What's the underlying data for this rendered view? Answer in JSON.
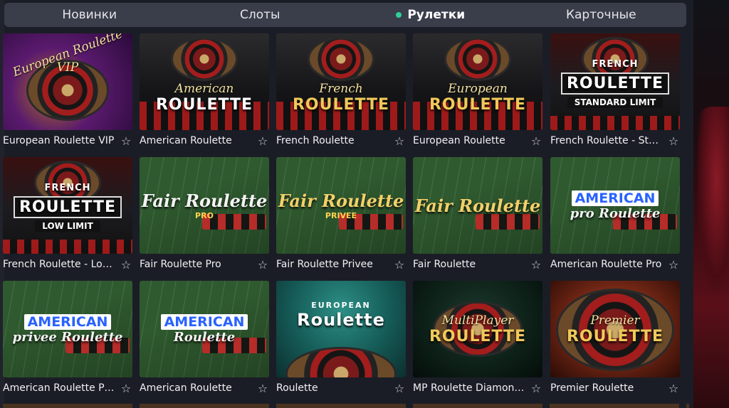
{
  "tabs": [
    {
      "label": "Новинки",
      "active": false
    },
    {
      "label": "Слоты",
      "active": false
    },
    {
      "label": "Рулетки",
      "active": true
    },
    {
      "label": "Карточные",
      "active": false
    }
  ],
  "accent_color": "#2fcf9a",
  "games": [
    {
      "title": "European Roulette VIP",
      "logo_lines": [
        "European Roulette",
        "VIP"
      ],
      "style": "vip"
    },
    {
      "title": "American Roulette",
      "logo_lines": [
        "American",
        "ROULETTE"
      ],
      "style": "dark"
    },
    {
      "title": "French Roulette",
      "logo_lines": [
        "French",
        "ROULETTE"
      ],
      "style": "dark-gold"
    },
    {
      "title": "European Roulette",
      "logo_lines": [
        "European",
        "ROULETTE"
      ],
      "style": "dark-gold"
    },
    {
      "title": "French Roulette - Stand...",
      "logo_lines": [
        "FRENCH",
        "ROULETTE",
        "STANDARD LIMIT"
      ],
      "style": "boxed"
    },
    {
      "title": "French Roulette - Low ...",
      "logo_lines": [
        "FRENCH",
        "ROULETTE",
        "LOW LIMIT"
      ],
      "style": "boxed"
    },
    {
      "title": "Fair Roulette Pro",
      "logo_lines": [
        "Fair Roulette",
        "PRO"
      ],
      "style": "green"
    },
    {
      "title": "Fair Roulette Privee",
      "logo_lines": [
        "Fair Roulette",
        "PRIVEE"
      ],
      "style": "green-gold"
    },
    {
      "title": "Fair Roulette",
      "logo_lines": [
        "Fair Roulette",
        ""
      ],
      "style": "green-gold"
    },
    {
      "title": "American Roulette Pro",
      "logo_lines": [
        "AMERICAN",
        "pro Roulette"
      ],
      "style": "green-blue"
    },
    {
      "title": "American Roulette Pri...",
      "logo_lines": [
        "AMERICAN",
        "privee Roulette"
      ],
      "style": "green-blue"
    },
    {
      "title": "American Roulette",
      "logo_lines": [
        "AMERICAN",
        "Roulette"
      ],
      "style": "green-blue"
    },
    {
      "title": "Roulette",
      "logo_lines": [
        "EUROPEAN",
        "Roulette"
      ],
      "style": "teal"
    },
    {
      "title": "MP Roulette Diamond ...",
      "logo_lines": [
        "MultiPlayer",
        "ROULETTE"
      ],
      "style": "mp"
    },
    {
      "title": "Premier Roulette",
      "logo_lines": [
        "Premier",
        "ROULETTE"
      ],
      "style": "premier"
    }
  ]
}
